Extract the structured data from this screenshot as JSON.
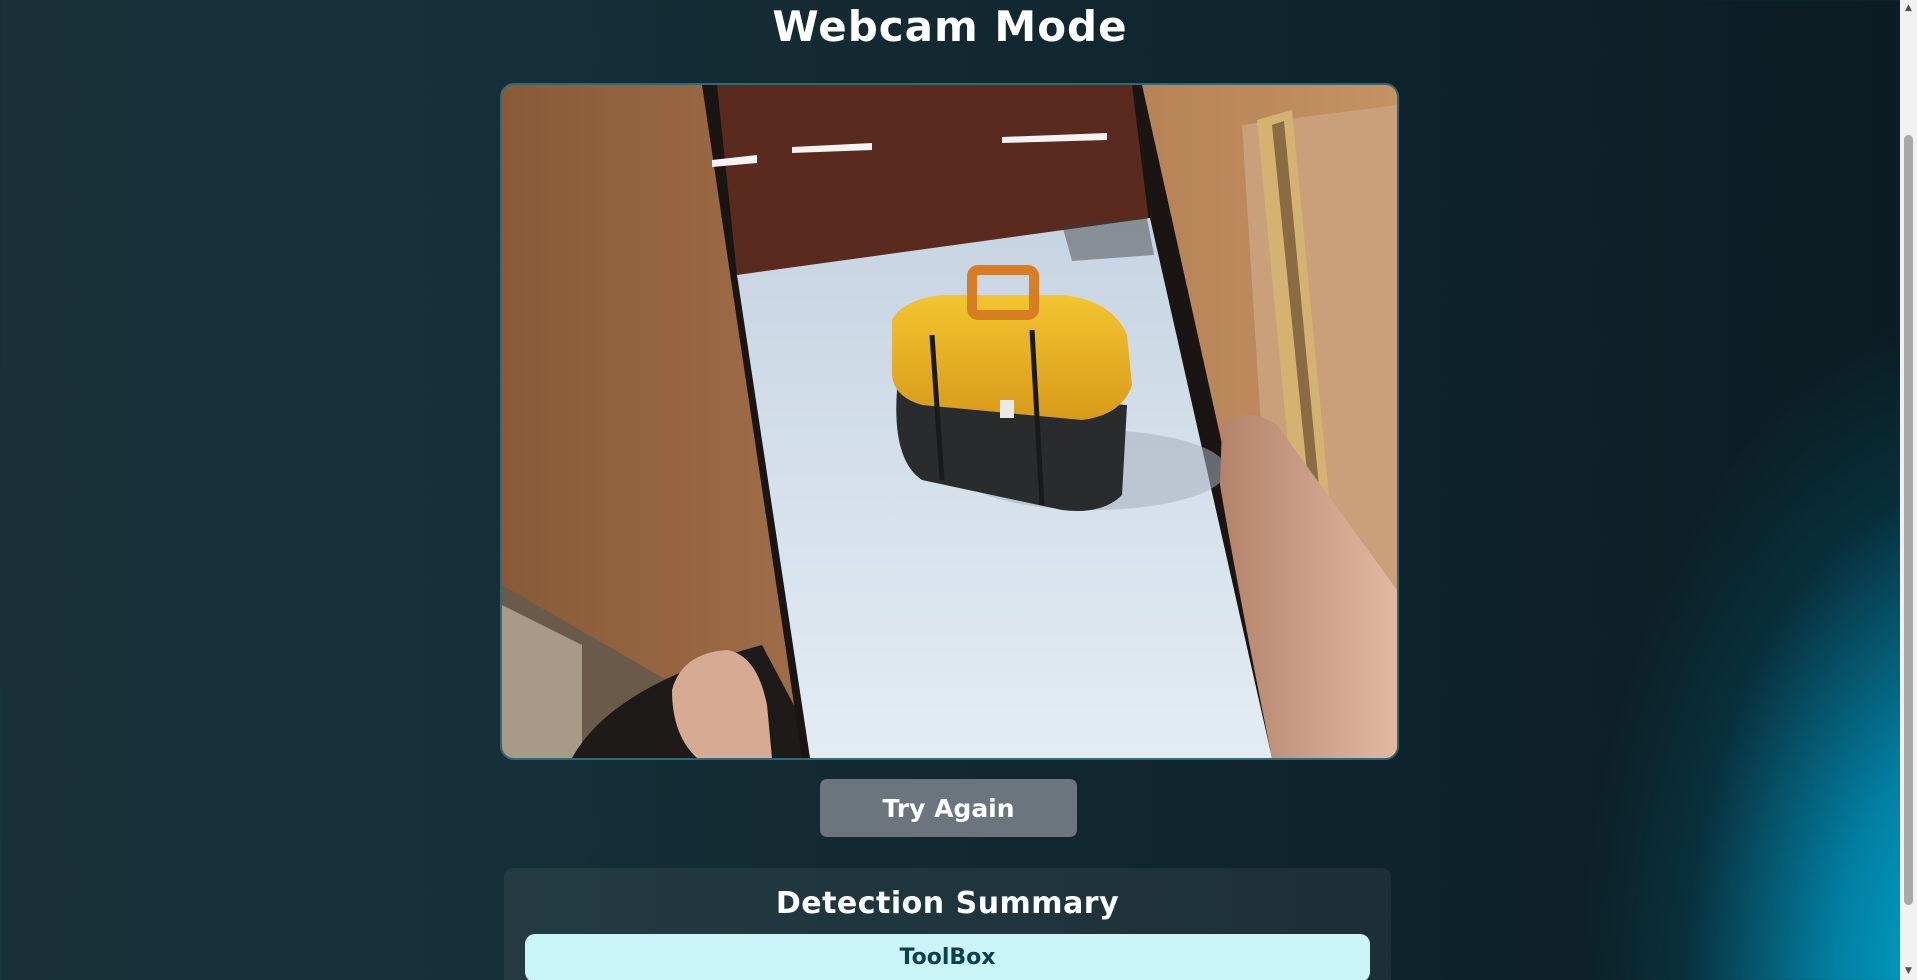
{
  "page": {
    "title": "Webcam Mode"
  },
  "webcam": {
    "subject_icon": "toolbox-icon"
  },
  "actions": {
    "try_again_label": "Try Again"
  },
  "summary": {
    "title": "Detection Summary",
    "detections": [
      "ToolBox"
    ]
  },
  "colors": {
    "accent": "#00b5e0",
    "button_bg": "#6c757d",
    "pill_bg": "#c9f4f8",
    "pill_text": "#0e3f4c"
  },
  "scrollbar": {
    "up_icon": "chevron-up-icon",
    "down_icon": "chevron-down-icon"
  }
}
